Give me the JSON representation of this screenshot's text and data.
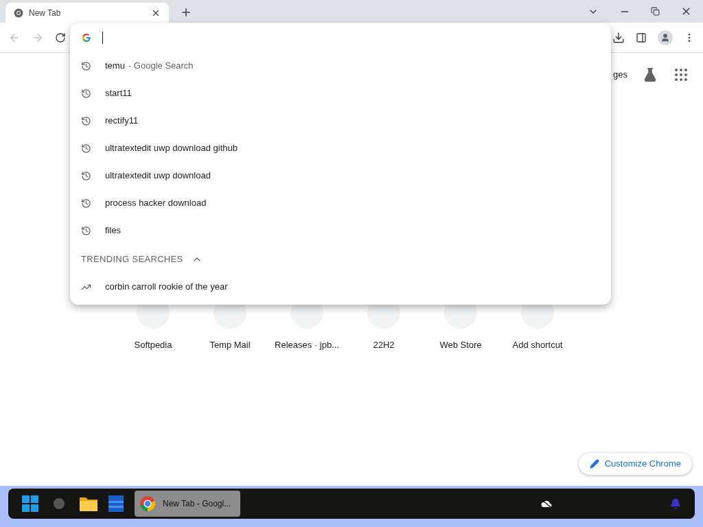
{
  "tab": {
    "title": "New Tab",
    "selected": true
  },
  "suggestions": [
    {
      "kind": "history",
      "text": "temu",
      "suffix": "- Google Search"
    },
    {
      "kind": "history",
      "text": "start11"
    },
    {
      "kind": "history",
      "text": "rectify11"
    },
    {
      "kind": "history",
      "text": "ultratextedit uwp download github"
    },
    {
      "kind": "history",
      "text": "ultratextedit uwp download"
    },
    {
      "kind": "history",
      "text": "process hacker download"
    },
    {
      "kind": "history",
      "text": "files"
    }
  ],
  "trending": {
    "heading": "TRENDING SEARCHES",
    "expanded": true,
    "items": [
      {
        "text": "corbin carroll rookie of the year"
      }
    ]
  },
  "header_links": [
    {
      "text": "ges"
    }
  ],
  "shortcuts": [
    {
      "label": "Softpedia"
    },
    {
      "label": "Temp Mail"
    },
    {
      "label": "Releases · jpb..."
    },
    {
      "label": "22H2"
    },
    {
      "label": "Web Store"
    },
    {
      "label": "Add shortcut"
    }
  ],
  "customize_button": "Customize Chrome",
  "taskbar": {
    "items": [
      {
        "label": "New Tab - Googl...",
        "selected": true
      }
    ]
  }
}
